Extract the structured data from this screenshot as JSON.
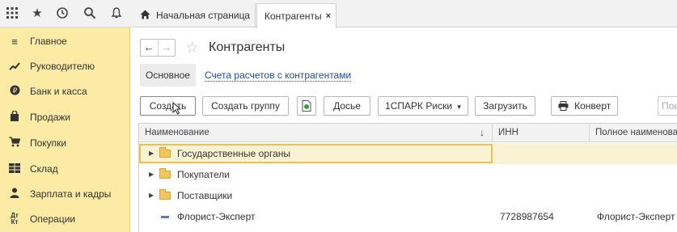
{
  "topbar": {
    "icons": [
      "apps-grid-icon",
      "star-icon",
      "history-icon",
      "search-icon",
      "bell-icon"
    ],
    "tabs": [
      {
        "label": "Начальная страница",
        "icon": "home-icon"
      },
      {
        "label": "Контрагенты",
        "close": "×"
      }
    ]
  },
  "sidebar": {
    "items": [
      {
        "label": "Главное",
        "icon": "menu-lines-icon"
      },
      {
        "label": "Руководителю",
        "icon": "trend-icon"
      },
      {
        "label": "Банк и касса",
        "icon": "coin-icon"
      },
      {
        "label": "Продажи",
        "icon": "bag-icon"
      },
      {
        "label": "Покупки",
        "icon": "cart-icon"
      },
      {
        "label": "Склад",
        "icon": "warehouse-icon"
      },
      {
        "label": "Зарплата и кадры",
        "icon": "person-icon"
      },
      {
        "label": "Операции",
        "icon": "dt-kt-icon"
      }
    ],
    "accent": "#fbeba4"
  },
  "main": {
    "title": "Контрагенты",
    "subtabs": {
      "main": "Основное",
      "link": "Счета расчетов с контрагентами"
    },
    "toolbar": {
      "create": "Создать",
      "create_group": "Создать группу",
      "dossier": "Досье",
      "spark": "1СПАРК Риски",
      "spark_arrow": "▾",
      "load": "Загрузить",
      "envelope": "Конверт",
      "search_placeholder": "Пои"
    },
    "table": {
      "columns": [
        "Наименование",
        "ИНН",
        "Полное наименова"
      ],
      "sort_arrow": "↓",
      "rows": [
        {
          "name": "Государственные органы",
          "inn": "",
          "full": "",
          "type": "folder",
          "selected": true
        },
        {
          "name": "Покупатели",
          "inn": "",
          "full": "",
          "type": "folder"
        },
        {
          "name": "Поставщики",
          "inn": "",
          "full": "",
          "type": "folder"
        },
        {
          "name": "Флорист-Эксперт",
          "inn": "7728987654",
          "full": "Флорист-Эксперт",
          "type": "item"
        }
      ]
    }
  }
}
